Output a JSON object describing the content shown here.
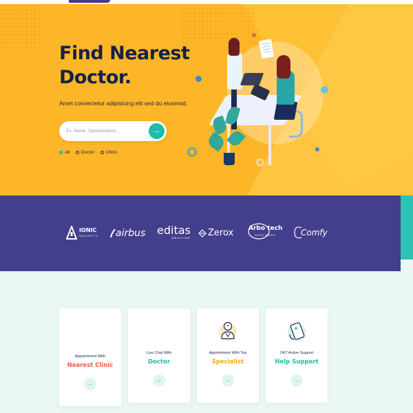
{
  "hero": {
    "title_line1": "Find Nearest",
    "title_line2": "Doctor.",
    "subtitle": "Amet consectetur adipisicing elit sed do eiusmod.",
    "search": {
      "placeholder": "Ex. Name, Specialization...",
      "value": "",
      "button_icon": "arrow-right-icon"
    },
    "filters": [
      {
        "label": "All",
        "selected": true
      },
      {
        "label": "Doctor",
        "selected": false
      },
      {
        "label": "Clinic",
        "selected": false
      }
    ]
  },
  "logos": [
    {
      "name": "IONIC",
      "sub": "SECURITY",
      "icon": "triangle-logo-icon"
    },
    {
      "name": "airbus",
      "sub": "",
      "icon": "swoosh-logo-icon"
    },
    {
      "name": "editas",
      "sub": "MEDICINE",
      "icon": ""
    },
    {
      "name": "Zerox",
      "sub": "",
      "icon": "diamond-logo-icon"
    },
    {
      "name": "Arbo tech",
      "sub": "SOFTWARE",
      "icon": "circle-logo-icon"
    },
    {
      "name": "Comfy",
      "sub": "",
      "icon": "loop-logo-icon"
    }
  ],
  "features": [
    {
      "line1": "Appointment With",
      "line2": "Nearest Clinic",
      "color": "#ef5a4a",
      "icon": ""
    },
    {
      "line1": "Live Chat With",
      "line2": "Doctor",
      "color": "#1fbcab",
      "icon": ""
    },
    {
      "line1": "Appointment With Top",
      "line2": "Specialist",
      "color": "#f5ab18",
      "icon": "specialist-doctor-icon"
    },
    {
      "line1": "24/7 Active Support",
      "line2": "Help Support",
      "color": "#1fbcab",
      "icon": "phone-support-icon"
    }
  ],
  "colors": {
    "hero_bg": "#fdb627",
    "band_bg": "#443f8c",
    "accent_teal": "#1fbcab",
    "title_navy": "#14224b",
    "features_bg": "#eaf7f4"
  }
}
